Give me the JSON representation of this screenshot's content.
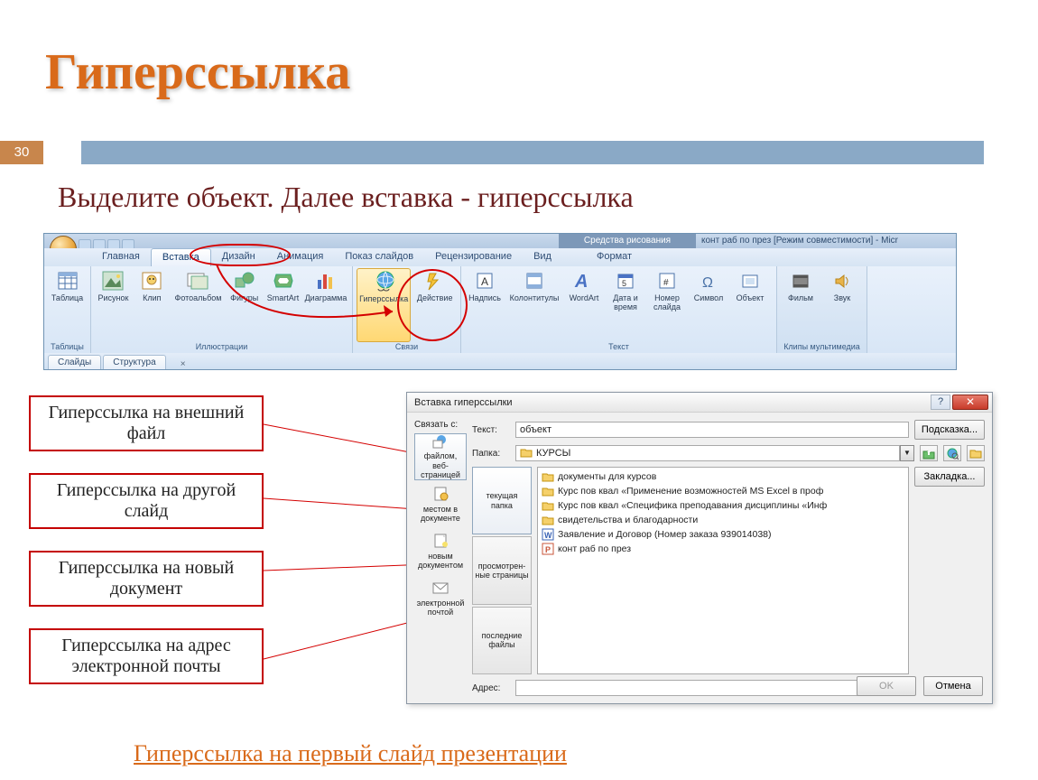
{
  "slide": {
    "title": "Гиперссылка",
    "number": "30",
    "instruction": "Выделите объект. Далее вставка - гиперссылка",
    "bottom_link": "Гиперссылка на первый слайд презентации"
  },
  "ribbon": {
    "context_title": "Средства рисования",
    "window_title": "конт раб по през [Режим совместимости] - Micr",
    "tabs": [
      "Главная",
      "Вставка",
      "Дизайн",
      "Анимация",
      "Показ слайдов",
      "Рецензирование",
      "Вид",
      "Формат"
    ],
    "active_tab_index": 1,
    "groups": {
      "tables": {
        "label": "Таблицы",
        "items": [
          "Таблица"
        ]
      },
      "illus": {
        "label": "Иллюстрации",
        "items": [
          "Рисунок",
          "Клип",
          "Фотоальбом",
          "Фигуры",
          "SmartArt",
          "Диаграмма"
        ]
      },
      "links": {
        "label": "Связи",
        "items": [
          "Гиперссылка",
          "Действие"
        ]
      },
      "text": {
        "label": "Текст",
        "items": [
          "Надпись",
          "Колонтитулы",
          "WordArt",
          "Дата и время",
          "Номер слайда",
          "Символ",
          "Объект"
        ]
      },
      "media": {
        "label": "Клипы мультимедиа",
        "items": [
          "Фильм",
          "Звук"
        ]
      }
    },
    "panel_tabs": [
      "Слайды",
      "Структура"
    ]
  },
  "callouts": [
    "Гиперссылка на внешний файл",
    "Гиперссылка на другой слайд",
    "Гиперссылка на новый документ",
    "Гиперссылка на адрес электронной почты"
  ],
  "dialog": {
    "title": "Вставка гиперссылки",
    "link_with_label": "Связать с:",
    "text_label": "Текст:",
    "text_value": "объект",
    "folder_label": "Папка:",
    "folder_value": "КУРСЫ",
    "address_label": "Адрес:",
    "address_value": "",
    "tooltip_btn": "Подсказка...",
    "bookmark_btn": "Закладка...",
    "ok_btn": "OK",
    "cancel_btn": "Отмена",
    "link_options": [
      "файлом, веб-страницей",
      "местом в документе",
      "новым документом",
      "электронной почтой"
    ],
    "view_options": [
      "текущая папка",
      "просмотрен-ные страницы",
      "последние файлы"
    ],
    "files": [
      {
        "icon": "folder",
        "name": "документы для курсов"
      },
      {
        "icon": "folder",
        "name": "Курс пов квал «Применение возможностей MS Excel в проф"
      },
      {
        "icon": "folder",
        "name": "Курс пов квал «Специфика преподавания дисциплины «Инф"
      },
      {
        "icon": "folder",
        "name": "свидетельства и благодарности"
      },
      {
        "icon": "word",
        "name": "Заявление и Договор (Номер заказа 939014038)"
      },
      {
        "icon": "ppt",
        "name": "конт раб по през"
      }
    ]
  }
}
